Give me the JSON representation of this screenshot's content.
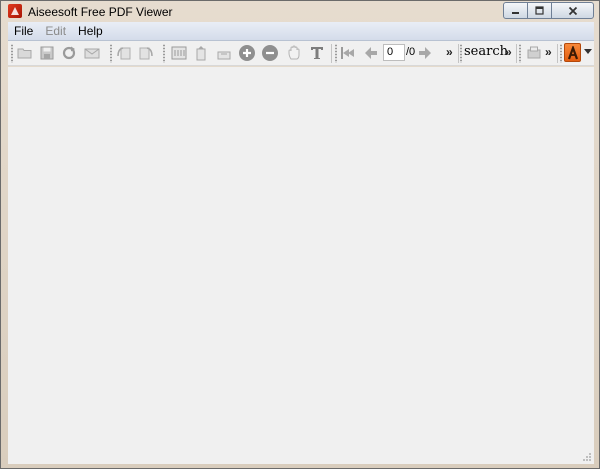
{
  "window": {
    "title": "Aiseesoft Free PDF Viewer",
    "controls": {
      "minimize": "–",
      "maximize": "□",
      "close": "✕"
    }
  },
  "menu": {
    "items": [
      {
        "label": "File",
        "enabled": true
      },
      {
        "label": "Edit",
        "enabled": false
      },
      {
        "label": "Help",
        "enabled": true
      }
    ]
  },
  "toolbar": {
    "page_value": "0",
    "page_total": "/0",
    "search_label": "search",
    "overflow_label": "»"
  },
  "colors": {
    "accent": "#ee6a1e",
    "app_icon": "#c8200c",
    "content_bg": "#f0f0f0"
  },
  "icons": [
    "open-icon",
    "save-icon",
    "reload-icon",
    "email-icon",
    "rotate-left-icon",
    "rotate-right-icon",
    "fit-page-icon",
    "fit-width-icon",
    "actual-size-icon",
    "zoom-in-icon",
    "zoom-out-icon",
    "hand-tool-icon",
    "text-select-icon",
    "first-page-icon",
    "prev-page-icon",
    "next-page-icon",
    "print-icon",
    "aiseesoft-logo-icon",
    "dropdown-arrow-icon"
  ]
}
